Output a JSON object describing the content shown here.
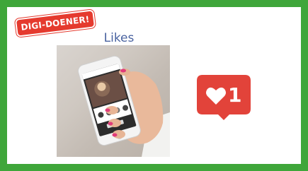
{
  "brand": {
    "badge_text": "DIGI-DOENER!",
    "frame_color": "#3fa63a",
    "badge_color": "#e53a2e"
  },
  "slide": {
    "title": "Likes"
  },
  "like_notification": {
    "icon": "heart-icon",
    "count": "1",
    "color": "#e2433a"
  }
}
